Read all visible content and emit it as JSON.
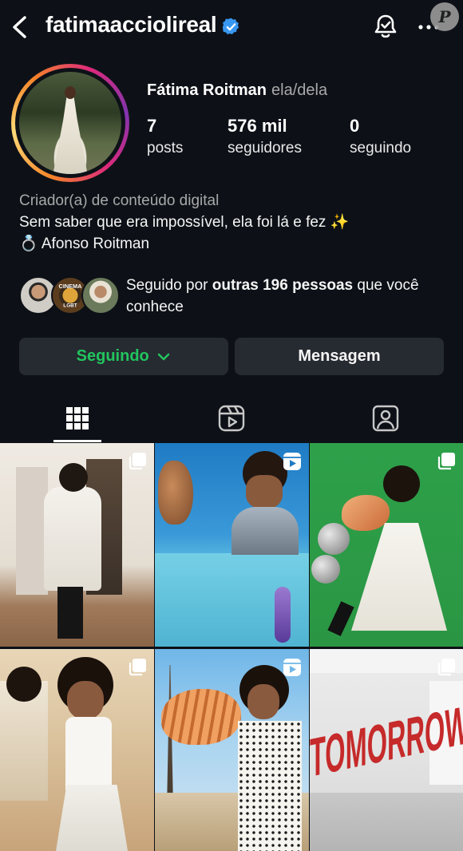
{
  "header": {
    "username": "fatimaacciolireal",
    "verified": true
  },
  "watermark": "P",
  "profile": {
    "display_name": "Fátima Roitman",
    "pronouns": "ela/dela",
    "stats": [
      {
        "value": "7",
        "label": "posts"
      },
      {
        "value": "576 mil",
        "label": "seguidores"
      },
      {
        "value": "0",
        "label": "seguindo"
      }
    ],
    "category": "Criador(a) de conteúdo digital",
    "bio_line1": "Sem saber que era impossível, ela foi lá e fez ✨",
    "bio_line2": "💍 Afonso Roitman"
  },
  "mutual": {
    "prefix": "Seguido por ",
    "bold": "outras 196 pessoas",
    "suffix": " que você conhece"
  },
  "actions": {
    "following_label": "Seguindo",
    "message_label": "Mensagem"
  },
  "tabs": [
    {
      "icon": "grid-icon",
      "active": true
    },
    {
      "icon": "reels-icon",
      "active": false
    },
    {
      "icon": "tagged-icon",
      "active": false
    }
  ],
  "posts": [
    {
      "type": "carousel"
    },
    {
      "type": "reel"
    },
    {
      "type": "carousel"
    },
    {
      "type": "carousel"
    },
    {
      "type": "reel"
    },
    {
      "type": "carousel",
      "caption": "TOMORROW"
    }
  ],
  "colors": {
    "background": "#0d1117",
    "button": "#262a31",
    "following": "#22c55e",
    "verified": "#3897f0"
  }
}
